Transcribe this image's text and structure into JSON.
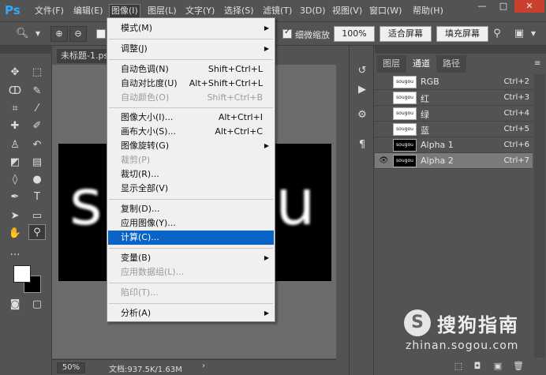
{
  "app": {
    "logo": "Ps"
  },
  "menubar": {
    "items": [
      "文件(F)",
      "编辑(E)",
      "图像(I)",
      "图层(L)",
      "文字(Y)",
      "选择(S)",
      "滤镜(T)",
      "3D(D)",
      "视图(V)",
      "窗口(W)",
      "帮助(H)"
    ],
    "active_index": 2,
    "window_min": "—",
    "window_max": "□",
    "window_close": "✕"
  },
  "optionsbar": {
    "scrubby_zoom_label": "细微缩放",
    "zoom_value": "100%",
    "fit_screen": "适合屏幕",
    "fill_screen": "填充屏幕"
  },
  "document": {
    "tab_title": "未标题-1.psd",
    "canvas_text": "sougou",
    "zoom": "50%",
    "doc_info": "文档:937.5K/1.63M",
    "status_arrow": "›"
  },
  "image_menu": {
    "items": [
      {
        "label": "模式(M)",
        "shortcut": "",
        "submenu": true,
        "disabled": false
      },
      {
        "label": "调整(J)",
        "shortcut": "",
        "submenu": true,
        "disabled": false
      },
      {
        "label": "自动色调(N)",
        "shortcut": "Shift+Ctrl+L",
        "submenu": false,
        "disabled": false
      },
      {
        "label": "自动对比度(U)",
        "shortcut": "Alt+Shift+Ctrl+L",
        "submenu": false,
        "disabled": false
      },
      {
        "label": "自动颜色(O)",
        "shortcut": "Shift+Ctrl+B",
        "submenu": false,
        "disabled": true
      },
      {
        "label": "图像大小(I)...",
        "shortcut": "Alt+Ctrl+I",
        "submenu": false,
        "disabled": false
      },
      {
        "label": "画布大小(S)...",
        "shortcut": "Alt+Ctrl+C",
        "submenu": false,
        "disabled": false
      },
      {
        "label": "图像旋转(G)",
        "shortcut": "",
        "submenu": true,
        "disabled": false
      },
      {
        "label": "裁剪(P)",
        "shortcut": "",
        "submenu": false,
        "disabled": true
      },
      {
        "label": "裁切(R)...",
        "shortcut": "",
        "submenu": false,
        "disabled": false
      },
      {
        "label": "显示全部(V)",
        "shortcut": "",
        "submenu": false,
        "disabled": false
      },
      {
        "label": "复制(D)...",
        "shortcut": "",
        "submenu": false,
        "disabled": false
      },
      {
        "label": "应用图像(Y)...",
        "shortcut": "",
        "submenu": false,
        "disabled": false
      },
      {
        "label": "计算(C)...",
        "shortcut": "",
        "submenu": false,
        "disabled": false,
        "highlighted": true
      },
      {
        "label": "变量(B)",
        "shortcut": "",
        "submenu": true,
        "disabled": false
      },
      {
        "label": "应用数据组(L)...",
        "shortcut": "",
        "submenu": false,
        "disabled": true
      },
      {
        "label": "陷印(T)...",
        "shortcut": "",
        "submenu": false,
        "disabled": true
      },
      {
        "label": "分析(A)",
        "shortcut": "",
        "submenu": true,
        "disabled": false
      }
    ]
  },
  "panel": {
    "tabs": [
      "图层",
      "通道",
      "路径"
    ],
    "active_tab": 1,
    "menu_icon": "≡",
    "channels": [
      {
        "name": "RGB",
        "shortcut": "Ctrl+2",
        "thumb": "sougou",
        "dark": false,
        "visible": false,
        "selected": false
      },
      {
        "name": "红",
        "shortcut": "Ctrl+3",
        "thumb": "sougou",
        "dark": false,
        "visible": false,
        "selected": false
      },
      {
        "name": "绿",
        "shortcut": "Ctrl+4",
        "thumb": "sougou",
        "dark": false,
        "visible": false,
        "selected": false
      },
      {
        "name": "蓝",
        "shortcut": "Ctrl+5",
        "thumb": "sougou",
        "dark": false,
        "visible": false,
        "selected": false
      },
      {
        "name": "Alpha 1",
        "shortcut": "Ctrl+6",
        "thumb": "sougou",
        "dark": true,
        "visible": false,
        "selected": false
      },
      {
        "name": "Alpha 2",
        "shortcut": "Ctrl+7",
        "thumb": "sougou",
        "dark": true,
        "visible": true,
        "selected": true
      }
    ]
  },
  "watermark": {
    "logo": "S",
    "brand": "搜狗指南",
    "url": "zhinan.sogou.com"
  },
  "colors": {
    "menu_highlight": "#0a64c8",
    "ui_gray": "#535353",
    "canvas_bg": "#6c6c6c",
    "close_red": "#c9402f"
  }
}
